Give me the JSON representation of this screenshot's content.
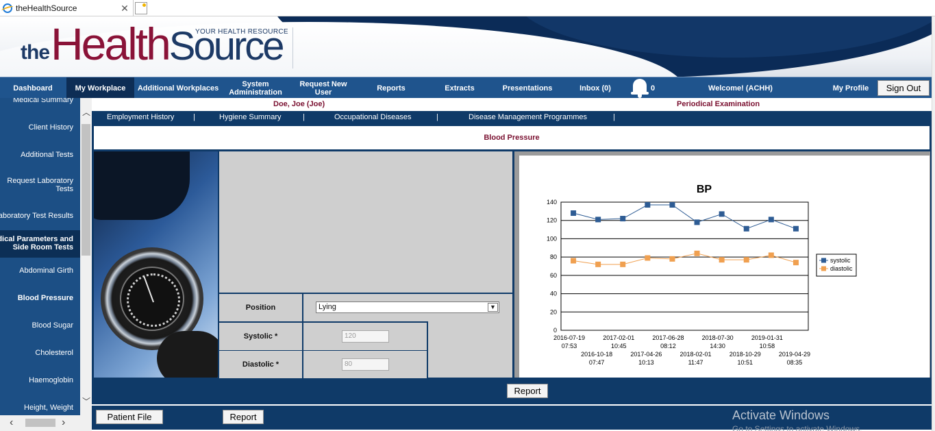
{
  "browser": {
    "tab_title": "theHealthSource",
    "tab_close": "✕"
  },
  "header": {
    "logo_the": "the",
    "logo_health": "Health",
    "logo_source": "Source",
    "tagline": "YOUR HEALTH RESOURCE"
  },
  "nav": {
    "items": [
      {
        "label": "Dashboard"
      },
      {
        "label": "My Workplace",
        "active": true
      },
      {
        "label": "Additional Workplaces"
      },
      {
        "label": "System Administration"
      },
      {
        "label": "Request New User"
      },
      {
        "label": "Reports"
      },
      {
        "label": "Extracts"
      },
      {
        "label": "Presentations"
      },
      {
        "label": "Inbox (0)"
      }
    ],
    "notification_count": "0",
    "welcome": "Welcome! (ACHH)",
    "my_profile": "My Profile",
    "sign_out": "Sign Out"
  },
  "sidebar": {
    "items": [
      {
        "label": "Medical Summary"
      },
      {
        "label": "Client History"
      },
      {
        "label": "Additional Tests"
      },
      {
        "label": "Request Laboratory Tests"
      },
      {
        "label": "Laboratory Test Results"
      },
      {
        "label": "Medical Parameters and Side Room Tests"
      },
      {
        "label": "Abdominal Girth"
      },
      {
        "label": "Blood Pressure"
      },
      {
        "label": "Blood Sugar"
      },
      {
        "label": "Cholesterol"
      },
      {
        "label": "Haemoglobin"
      },
      {
        "label": "Height, Weight"
      }
    ]
  },
  "patient": {
    "name": "Doe, Joe (Joe)",
    "exam": "Periodical Examination"
  },
  "subnav": {
    "items": [
      {
        "label": "Employment History"
      },
      {
        "label": "Hygiene Summary"
      },
      {
        "label": "Occupational Diseases"
      },
      {
        "label": "Disease Management Programmes"
      }
    ],
    "separator": "|"
  },
  "section": {
    "title": "Blood Pressure"
  },
  "form": {
    "position_label": "Position",
    "position_value": "Lying",
    "systolic_label": "Systolic *",
    "systolic_value": "120",
    "diastolic_label": "Diastolic *",
    "diastolic_value": "80"
  },
  "buttons": {
    "report_center": "Report",
    "patient_file": "Patient File",
    "report_bottom": "Report"
  },
  "os_watermark": {
    "title": "Activate Windows",
    "subtitle": "Go to Settings to activate Windows."
  },
  "colors": {
    "nav_blue": "#1f548d",
    "dark_blue": "#0f3a68",
    "maroon": "#7a1030",
    "systolic": "#2e5c94",
    "diastolic": "#f0a050"
  },
  "chart_data": {
    "type": "line",
    "title": "BP",
    "x": [
      [
        "2016-07-19",
        "07:53"
      ],
      [
        "2016-10-18",
        "07:47"
      ],
      [
        "2017-02-01",
        "10:45"
      ],
      [
        "2017-04-26",
        "10:13"
      ],
      [
        "2017-06-28",
        "08:12"
      ],
      [
        "2018-02-01",
        "11:47"
      ],
      [
        "2018-07-30",
        "14:30"
      ],
      [
        "2018-10-29",
        "10:51"
      ],
      [
        "2019-01-31",
        "10:58"
      ],
      [
        "2019-04-29",
        "08:35"
      ]
    ],
    "series": [
      {
        "name": "systolic",
        "color": "#2e5c94",
        "values": [
          128,
          121,
          122,
          137,
          137,
          118,
          127,
          111,
          121,
          111
        ]
      },
      {
        "name": "diastolic",
        "color": "#f0a050",
        "values": [
          76,
          72,
          72,
          79,
          78,
          84,
          77,
          77,
          82,
          74
        ]
      }
    ],
    "y_ticks": [
      0,
      20,
      40,
      60,
      80,
      100,
      120,
      140
    ],
    "ylim": [
      0,
      140
    ],
    "grid": true,
    "legend": "right"
  }
}
